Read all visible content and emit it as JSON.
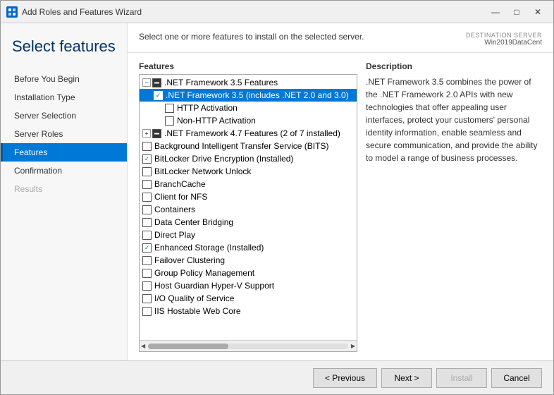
{
  "window": {
    "title": "Add Roles and Features Wizard"
  },
  "titlebar": {
    "minimize": "—",
    "maximize": "□",
    "close": "✕"
  },
  "sidebar": {
    "title": "Select features",
    "nav_items": [
      {
        "id": "before-you-begin",
        "label": "Before You Begin",
        "state": "normal"
      },
      {
        "id": "installation-type",
        "label": "Installation Type",
        "state": "normal"
      },
      {
        "id": "server-selection",
        "label": "Server Selection",
        "state": "normal"
      },
      {
        "id": "server-roles",
        "label": "Server Roles",
        "state": "normal"
      },
      {
        "id": "features",
        "label": "Features",
        "state": "active"
      },
      {
        "id": "confirmation",
        "label": "Confirmation",
        "state": "normal"
      },
      {
        "id": "results",
        "label": "Results",
        "state": "disabled"
      }
    ]
  },
  "main": {
    "description_text": "Select one or more features to install on the selected server.",
    "destination_label": "DESTINATION SERVER",
    "destination_server": "Win2019DataCent",
    "features_label": "Features",
    "description_label": "Description",
    "description_content": ".NET Framework 3.5 combines the power of the .NET Framework 2.0 APIs with new technologies that offer appealing user interfaces, protect your customers' personal identity information, enable seamless and secure communication, and provide the ability to model a range of business processes.",
    "features": [
      {
        "id": "net35-features",
        "label": ".NET Framework 3.5 Features",
        "checked": "partial",
        "indent": 0,
        "expandable": true
      },
      {
        "id": "net35",
        "label": ".NET Framework 3.5 (includes .NET 2.0 and 3.0)",
        "checked": "checked",
        "indent": 1,
        "highlighted": true
      },
      {
        "id": "http-activation",
        "label": "HTTP Activation",
        "checked": "unchecked",
        "indent": 2
      },
      {
        "id": "non-http-activation",
        "label": "Non-HTTP Activation",
        "checked": "unchecked",
        "indent": 2
      },
      {
        "id": "net47-features",
        "label": ".NET Framework 4.7 Features (2 of 7 installed)",
        "checked": "partial",
        "indent": 0,
        "expandable": false
      },
      {
        "id": "bits",
        "label": "Background Intelligent Transfer Service (BITS)",
        "checked": "unchecked",
        "indent": 0
      },
      {
        "id": "bitlocker-drive",
        "label": "BitLocker Drive Encryption (Installed)",
        "checked": "checked",
        "indent": 0
      },
      {
        "id": "bitlocker-network",
        "label": "BitLocker Network Unlock",
        "checked": "unchecked",
        "indent": 0
      },
      {
        "id": "branchcache",
        "label": "BranchCache",
        "checked": "unchecked",
        "indent": 0
      },
      {
        "id": "client-for-nfs",
        "label": "Client for NFS",
        "checked": "unchecked",
        "indent": 0
      },
      {
        "id": "containers",
        "label": "Containers",
        "checked": "unchecked",
        "indent": 0
      },
      {
        "id": "data-center-bridging",
        "label": "Data Center Bridging",
        "checked": "unchecked",
        "indent": 0
      },
      {
        "id": "direct-play",
        "label": "Direct Play",
        "checked": "unchecked",
        "indent": 0
      },
      {
        "id": "enhanced-storage",
        "label": "Enhanced Storage (Installed)",
        "checked": "checked",
        "indent": 0
      },
      {
        "id": "failover-clustering",
        "label": "Failover Clustering",
        "checked": "unchecked",
        "indent": 0
      },
      {
        "id": "group-policy",
        "label": "Group Policy Management",
        "checked": "unchecked",
        "indent": 0
      },
      {
        "id": "host-guardian",
        "label": "Host Guardian Hyper-V Support",
        "checked": "unchecked",
        "indent": 0
      },
      {
        "id": "io-quality",
        "label": "I/O Quality of Service",
        "checked": "unchecked",
        "indent": 0
      },
      {
        "id": "iis-hostable",
        "label": "IIS Hostable Web Core",
        "checked": "unchecked",
        "indent": 0
      }
    ]
  },
  "footer": {
    "previous_label": "< Previous",
    "next_label": "Next >",
    "install_label": "Install",
    "cancel_label": "Cancel"
  }
}
